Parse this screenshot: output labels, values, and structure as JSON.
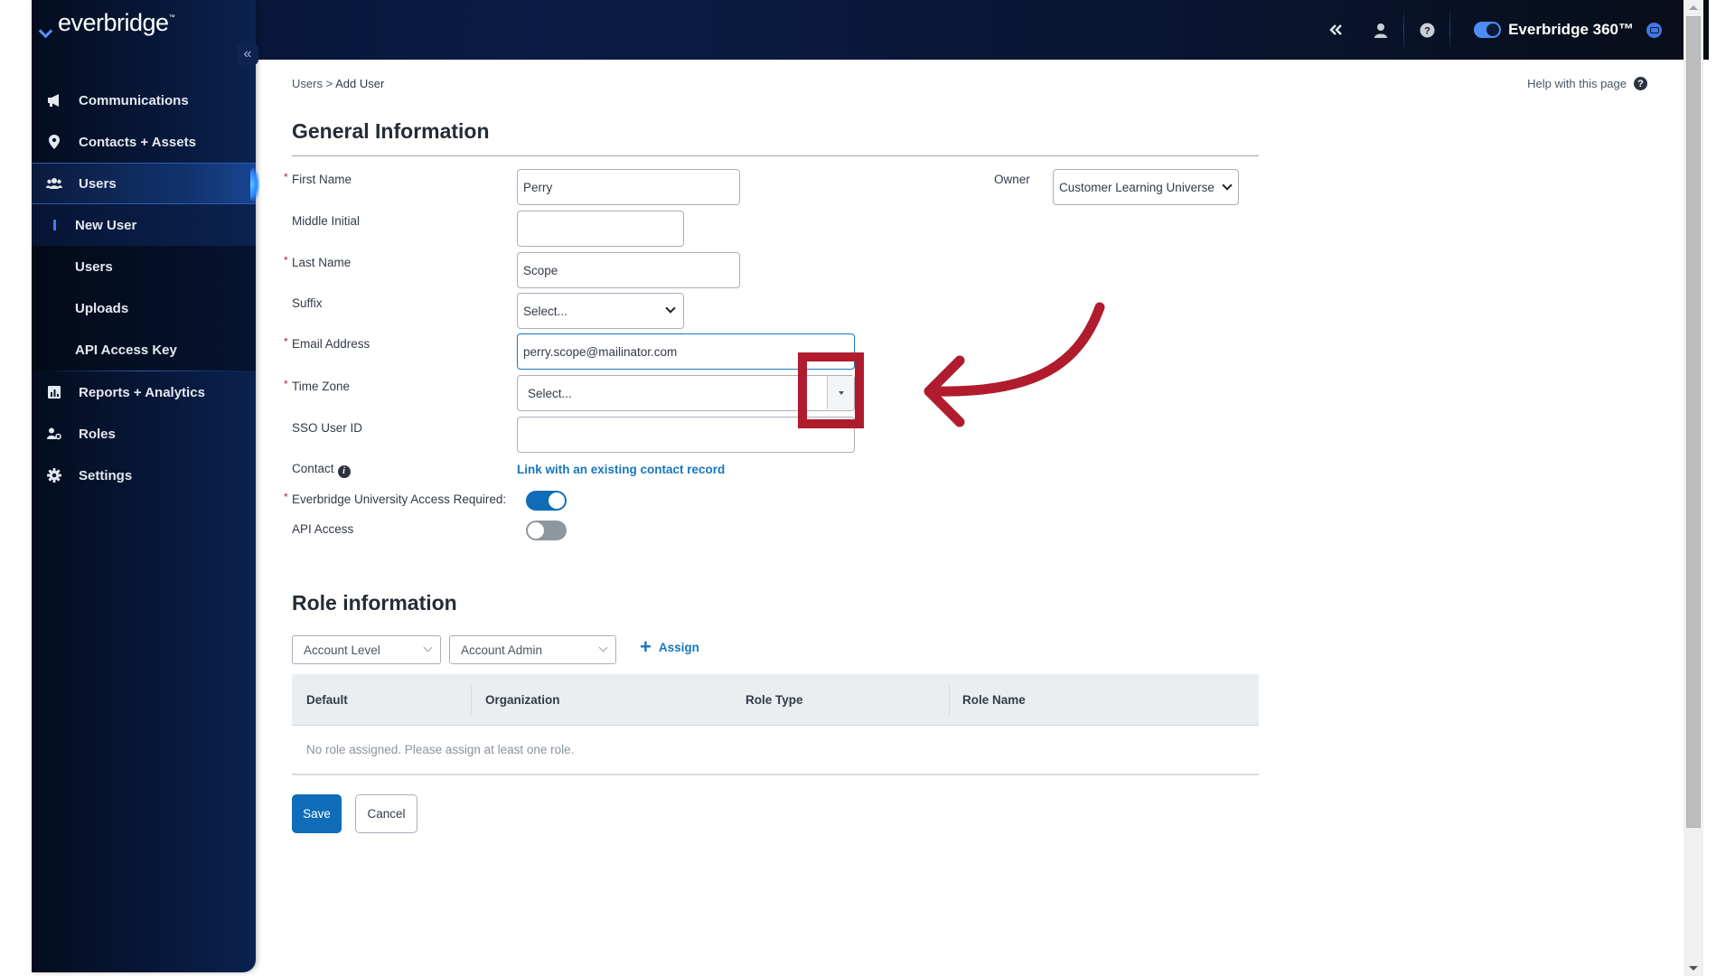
{
  "header": {
    "brand_label": "Everbridge 360™",
    "icons": [
      "double-chevron-left-icon",
      "user-icon",
      "help-circle-icon",
      "brand-toggle-icon",
      "chat-icon"
    ]
  },
  "sidebar": {
    "logo_text": "everbridge",
    "logo_tm": "™",
    "collapse_glyph": "«",
    "items": [
      {
        "label": "Communications",
        "icon": "megaphone-icon",
        "glyph": "◀"
      },
      {
        "label": "Contacts + Assets",
        "icon": "map-pin-icon",
        "glyph": "●"
      },
      {
        "label": "Users",
        "icon": "users-icon",
        "glyph": "●",
        "active": true
      },
      {
        "label": "Reports + Analytics",
        "icon": "chart-icon",
        "glyph": "■"
      },
      {
        "label": "Roles",
        "icon": "user-role-icon",
        "glyph": "●"
      },
      {
        "label": "Settings",
        "icon": "gear-icon",
        "glyph": "⚙"
      }
    ],
    "sub_items": [
      {
        "label": "New User",
        "current": true
      },
      {
        "label": "Users"
      },
      {
        "label": "Uploads"
      },
      {
        "label": "API Access Key"
      }
    ]
  },
  "breadcrumb": {
    "parent": "Users",
    "separator": ">",
    "current": "Add User"
  },
  "help": {
    "label": "Help with this page",
    "glyph": "?"
  },
  "general": {
    "title": "General Information",
    "fields": {
      "first_name": {
        "label": "First Name",
        "value": "Perry",
        "required": true
      },
      "middle_initial": {
        "label": "Middle Initial",
        "value": ""
      },
      "last_name": {
        "label": "Last Name",
        "value": "Scope",
        "required": true
      },
      "suffix": {
        "label": "Suffix",
        "value": "Select..."
      },
      "email": {
        "label": "Email Address",
        "value": "perry.scope@mailinator.com",
        "required": true
      },
      "time_zone": {
        "label": "Time Zone",
        "value": "Select...",
        "required": true
      },
      "sso_user_id": {
        "label": "SSO User ID",
        "value": ""
      },
      "contact": {
        "label": "Contact",
        "link": "Link with an existing contact record",
        "info_glyph": "i"
      },
      "university_access": {
        "label": "Everbridge University Access Required:",
        "on": true,
        "required": true
      },
      "api_access": {
        "label": "API Access",
        "on": false
      }
    },
    "owner": {
      "label": "Owner",
      "value": "Customer Learning Universe"
    },
    "required_marker": "*"
  },
  "role": {
    "title": "Role information",
    "level_select": "Account Level",
    "role_select": "Account Admin",
    "assign_label": "Assign",
    "assign_glyph": "+",
    "table": {
      "columns": [
        "Default",
        "Organization",
        "Role Type",
        "Role Name"
      ],
      "empty_message": "No role assigned. Please assign at least one role."
    }
  },
  "actions": {
    "save": "Save",
    "cancel": "Cancel"
  },
  "annotation": {
    "color": "#b01c2e",
    "target": "time-zone-dropdown-button"
  }
}
